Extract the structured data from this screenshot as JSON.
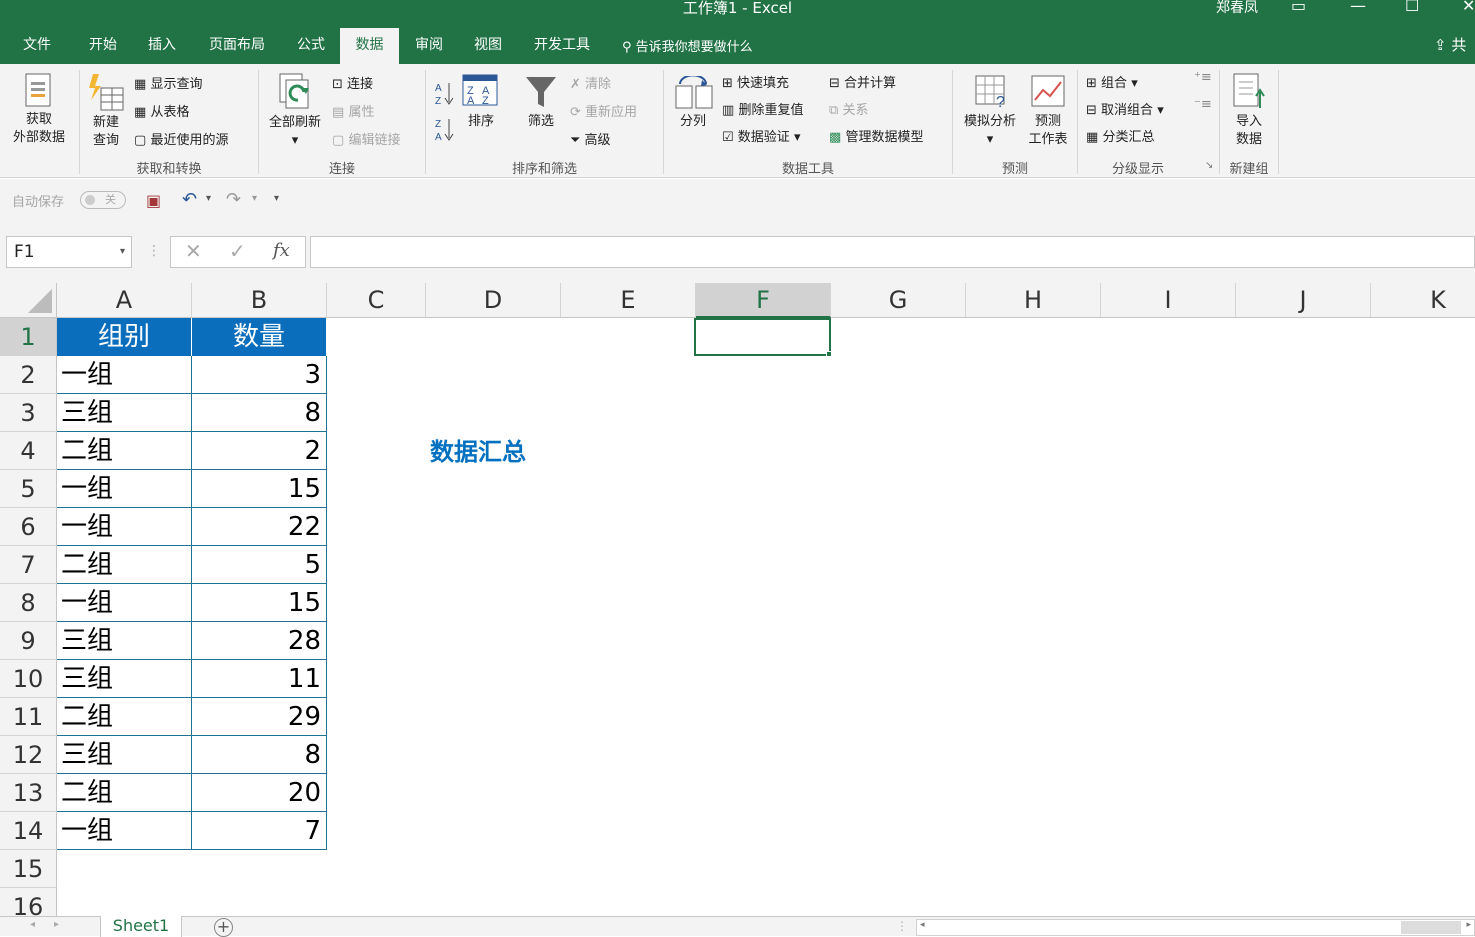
{
  "window": {
    "title": "工作簿1  -  Excel",
    "user": "郑春凤",
    "restore_glyph": "▭",
    "minimize_glyph": "—",
    "maximize_glyph": "☐",
    "close_glyph": "✕"
  },
  "tabs": [
    "文件",
    "开始",
    "插入",
    "页面布局",
    "公式",
    "数据",
    "审阅",
    "视图",
    "开发工具"
  ],
  "active_tab": "数据",
  "tell_me": "告诉我你想要做什么",
  "share": "共",
  "ribbon": {
    "get_external": "获取\n外部数据",
    "get_external_l1": "获取",
    "get_external_l2": "外部数据",
    "new_query_l1": "新建",
    "new_query_l2": "查询",
    "show_queries": "显示查询",
    "from_table": "从表格",
    "recent_sources": "最近使用的源",
    "group_get": "获取和转换",
    "refresh_all": "全部刷新",
    "connections": "连接",
    "properties": "属性",
    "edit_links": "编辑链接",
    "group_conn": "连接",
    "sort": "排序",
    "filter": "筛选",
    "clear": "清除",
    "reapply": "重新应用",
    "advanced": "高级",
    "group_sort": "排序和筛选",
    "text_to_columns": "分列",
    "flash_fill": "快速填充",
    "remove_dup": "删除重复值",
    "validation": "数据验证",
    "consolidate": "合并计算",
    "relationships": "关系",
    "data_model": "管理数据模型",
    "group_tools": "数据工具",
    "whatif": "模拟分析",
    "forecast_l1": "预测",
    "forecast_l2": "工作表",
    "group_forecast": "预测",
    "group": "组合",
    "ungroup": "取消组合",
    "subtotal": "分类汇总",
    "group_outline": "分级显示",
    "import_l1": "导入",
    "import_l2": "数据",
    "group_new": "新建组"
  },
  "qat": {
    "autosave": "自动保存",
    "autosave_state": "关"
  },
  "formula_bar": {
    "name_box": "F1",
    "formula": ""
  },
  "columns": [
    "A",
    "B",
    "C",
    "D",
    "E",
    "F",
    "G",
    "H",
    "I",
    "J",
    "K"
  ],
  "rows": [
    "1",
    "2",
    "3",
    "4",
    "5",
    "6",
    "7",
    "8",
    "9",
    "10",
    "11",
    "12",
    "13",
    "14",
    "15",
    "16"
  ],
  "table": {
    "headers": [
      "组别",
      "数量"
    ],
    "rows": [
      [
        "一组",
        "3"
      ],
      [
        "三组",
        "8"
      ],
      [
        "二组",
        "2"
      ],
      [
        "一组",
        "15"
      ],
      [
        "一组",
        "22"
      ],
      [
        "二组",
        "5"
      ],
      [
        "一组",
        "15"
      ],
      [
        "三组",
        "28"
      ],
      [
        "三组",
        "11"
      ],
      [
        "二组",
        "29"
      ],
      [
        "三组",
        "8"
      ],
      [
        "二组",
        "20"
      ],
      [
        "一组",
        "7"
      ]
    ]
  },
  "summary_label": "数据汇总",
  "sheet_tab": "Sheet1",
  "colors": {
    "excel_green": "#217346",
    "header_blue": "#0a6ebd",
    "summary_blue": "#0070c0"
  }
}
